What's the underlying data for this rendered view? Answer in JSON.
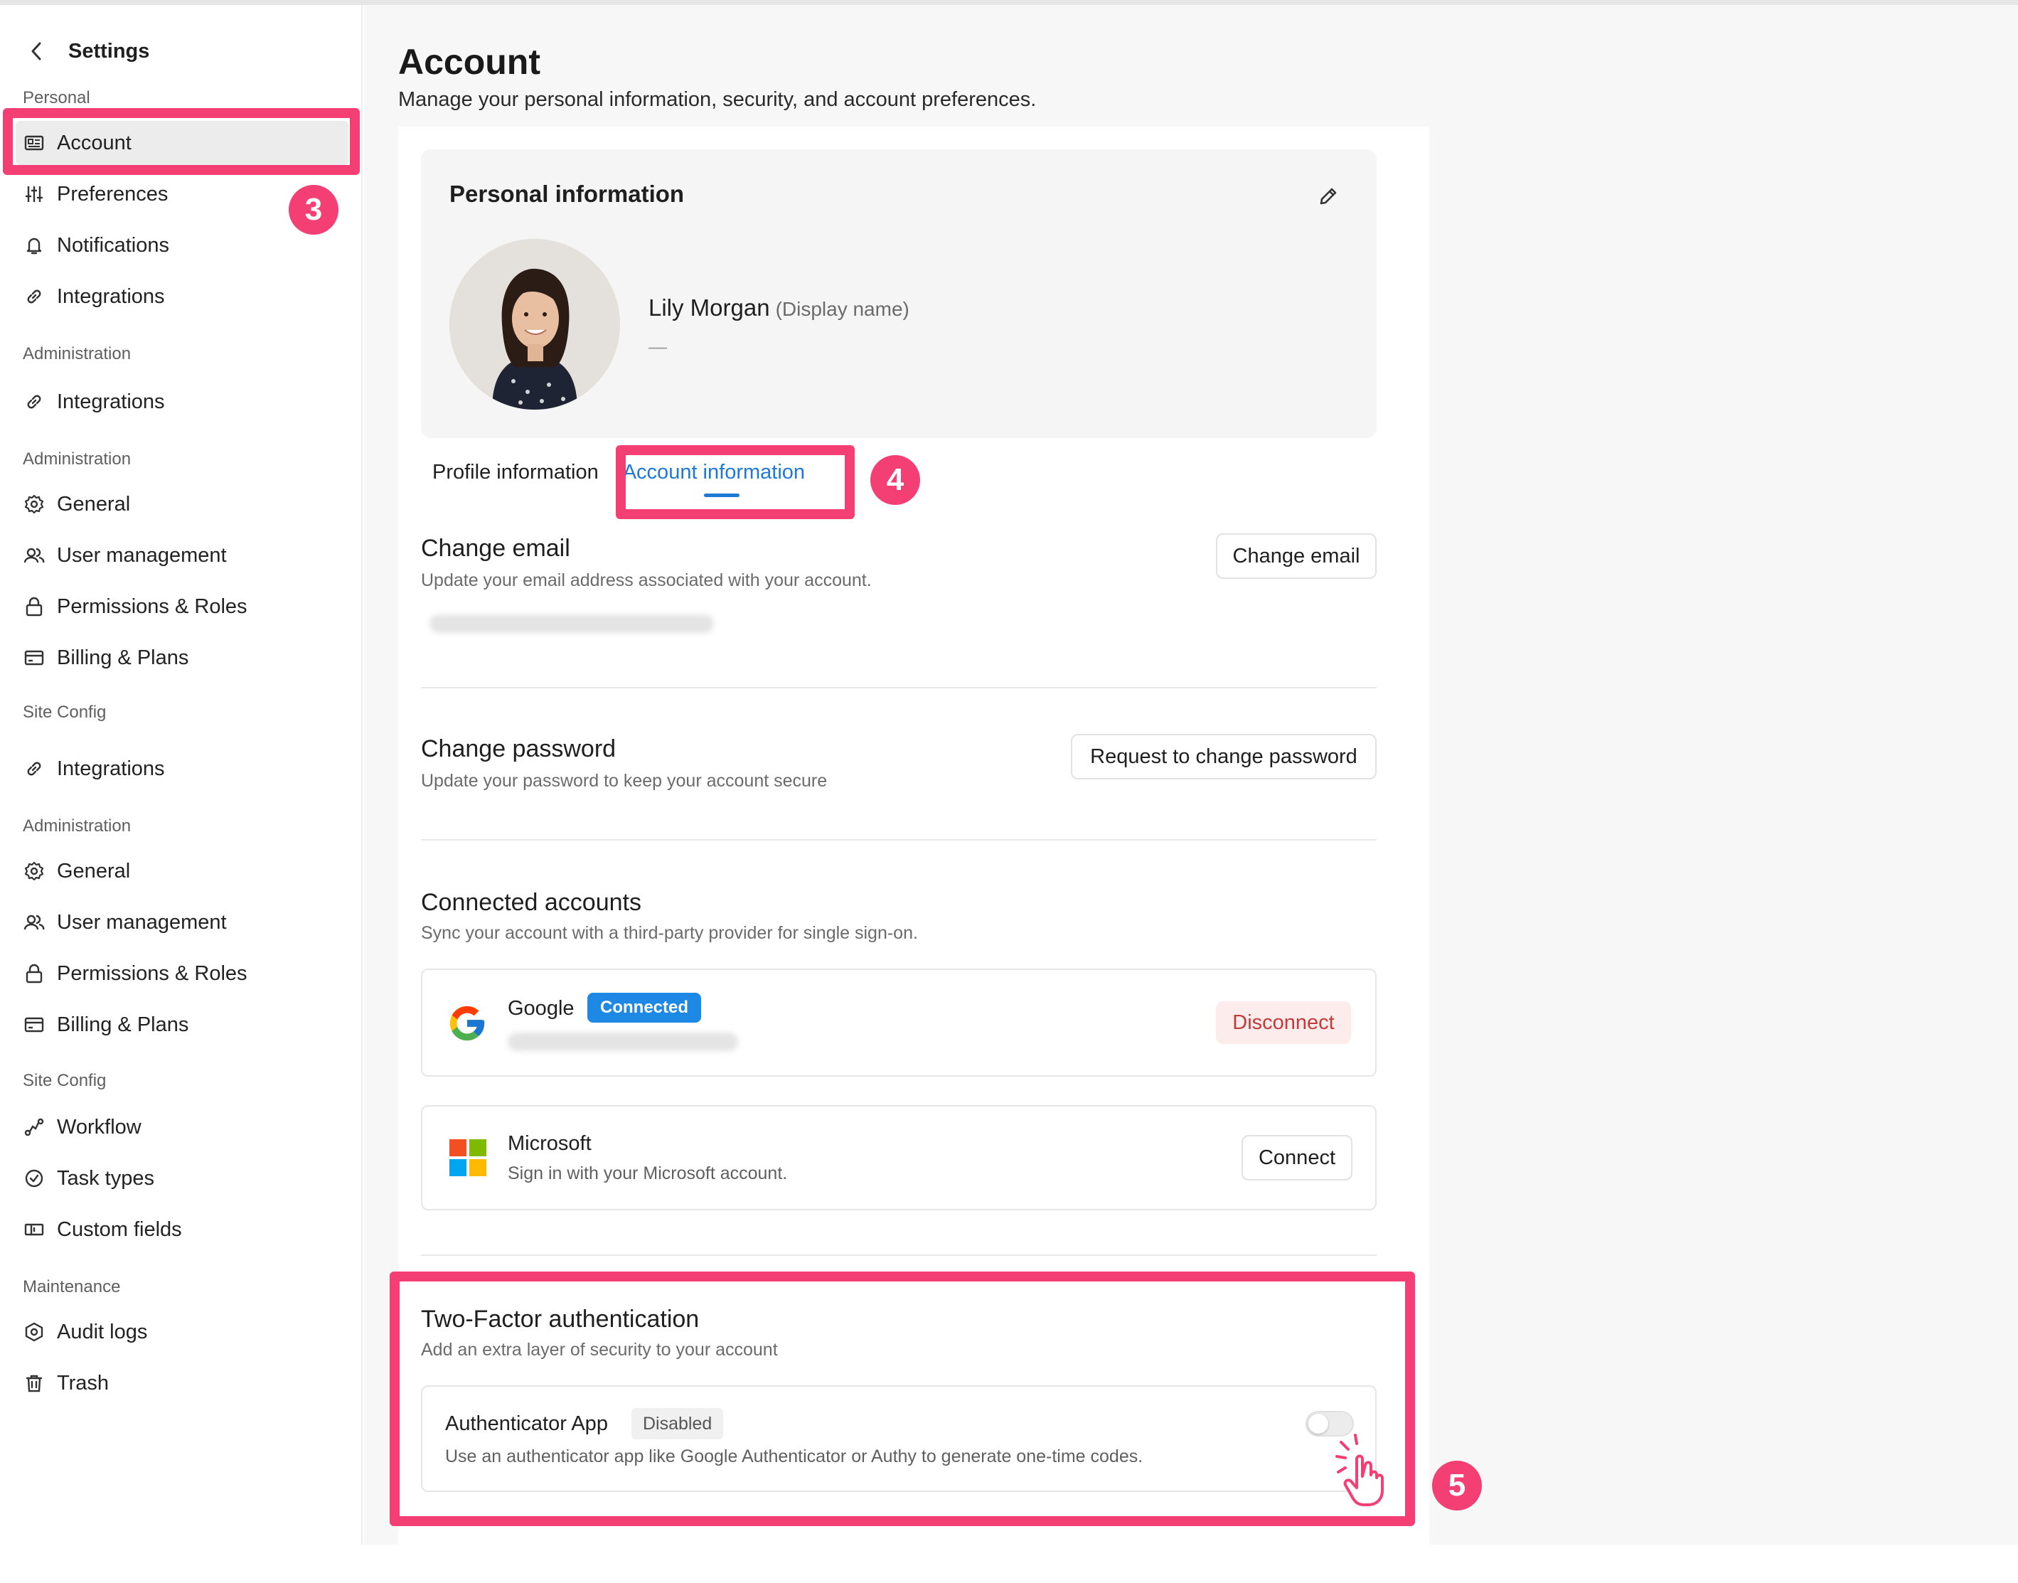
{
  "sidebar": {
    "title": "Settings",
    "sections": [
      {
        "label": "Personal"
      },
      {
        "label": "Administration"
      },
      {
        "label": "Administration"
      },
      {
        "label": "Site Config"
      },
      {
        "label": "Administration"
      },
      {
        "label": "Site Config"
      },
      {
        "label": "Maintenance"
      }
    ],
    "items": [
      {
        "label": "Account",
        "icon": "id-card-icon",
        "active": true
      },
      {
        "label": "Preferences",
        "icon": "sliders-icon"
      },
      {
        "label": "Notifications",
        "icon": "bell-icon"
      },
      {
        "label": "Integrations",
        "icon": "link-icon"
      },
      {
        "label": "Integrations",
        "icon": "link-icon"
      },
      {
        "label": "General",
        "icon": "gear-icon"
      },
      {
        "label": "User management",
        "icon": "users-icon"
      },
      {
        "label": "Permissions & Roles",
        "icon": "lock-icon"
      },
      {
        "label": "Billing & Plans",
        "icon": "credit-card-icon"
      },
      {
        "label": "Integrations",
        "icon": "link-icon"
      },
      {
        "label": "General",
        "icon": "gear-icon"
      },
      {
        "label": "User management",
        "icon": "users-icon"
      },
      {
        "label": "Permissions & Roles",
        "icon": "lock-icon"
      },
      {
        "label": "Billing & Plans",
        "icon": "credit-card-icon"
      },
      {
        "label": "Workflow",
        "icon": "workflow-icon"
      },
      {
        "label": "Task types",
        "icon": "check-circle-icon"
      },
      {
        "label": "Custom fields",
        "icon": "fields-icon"
      },
      {
        "label": "Audit logs",
        "icon": "shield-icon"
      },
      {
        "label": "Trash",
        "icon": "trash-icon"
      }
    ]
  },
  "page": {
    "title": "Account",
    "subtitle": "Manage your personal information, security, and account preferences."
  },
  "personal_info": {
    "title": "Personal information",
    "name": "Lily Morgan",
    "display_name_hint": "(Display name)",
    "secondary": "—"
  },
  "tabs": [
    {
      "label": "Profile information",
      "active": false
    },
    {
      "label": "Account information",
      "active": true
    }
  ],
  "change_email": {
    "title": "Change email",
    "desc": "Update your email address associated with your account.",
    "button": "Change email"
  },
  "change_password": {
    "title": "Change password",
    "desc": "Update your password to keep your account secure",
    "button": "Request to change password"
  },
  "connected_accounts": {
    "title": "Connected accounts",
    "desc": "Sync your account with a third-party provider for single sign-on.",
    "google": {
      "name": "Google",
      "badge": "Connected",
      "button": "Disconnect"
    },
    "microsoft": {
      "name": "Microsoft",
      "desc": "Sign in with your Microsoft account.",
      "button": "Connect"
    }
  },
  "two_factor": {
    "title": "Two-Factor authentication",
    "desc": "Add an extra layer of security to your account",
    "app_name": "Authenticator App",
    "status": "Disabled",
    "app_desc": "Use an authenticator app like Google Authenticator or Authy to generate one-time codes.",
    "enabled": false
  },
  "annotations": {
    "step3": "3",
    "step4": "4",
    "step5": "5",
    "color": "#f43f74"
  },
  "colors": {
    "accent": "#1e78d6",
    "badge": "#1e88e5",
    "danger_text": "#c23a3a",
    "danger_bg": "#fdecec"
  }
}
